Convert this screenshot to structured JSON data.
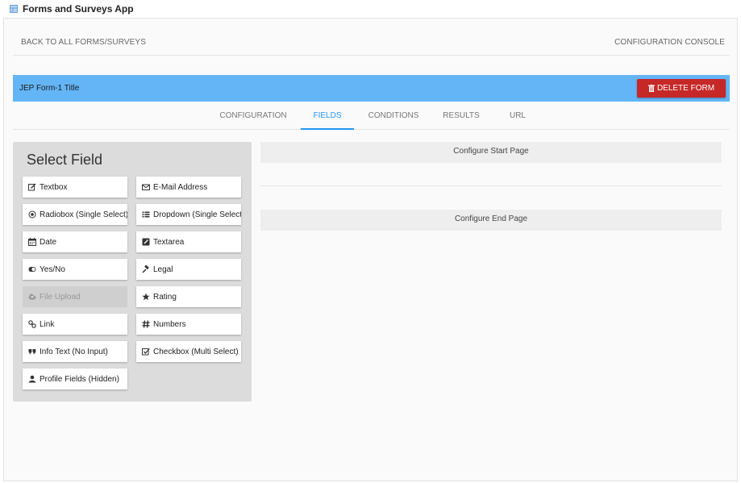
{
  "app": {
    "title": "Forms and Surveys App",
    "icon": "table-icon"
  },
  "topbar": {
    "back_label": "BACK TO ALL FORMS/SURVEYS",
    "console_label": "CONFIGURATION CONSOLE"
  },
  "form": {
    "title": "JEP Form-1 Title",
    "delete_label": "DELETE FORM",
    "banner_color": "#64b5f6",
    "delete_color": "#c62828"
  },
  "tabs": [
    {
      "label": "CONFIGURATION",
      "active": false
    },
    {
      "label": "FIELDS",
      "active": true
    },
    {
      "label": "CONDITIONS",
      "active": false
    },
    {
      "label": "RESULTS",
      "active": false
    },
    {
      "label": "URL",
      "active": false
    }
  ],
  "select_field": {
    "title": "Select Field",
    "fields": [
      {
        "label": "Textbox",
        "icon": "edit-icon",
        "enabled": true
      },
      {
        "label": "E-Mail Address",
        "icon": "envelope-icon",
        "enabled": true
      },
      {
        "label": "Radiobox (Single Select)",
        "icon": "radio-icon",
        "enabled": true
      },
      {
        "label": "Dropdown (Single Select)",
        "icon": "list-icon",
        "enabled": true
      },
      {
        "label": "Date",
        "icon": "calendar-icon",
        "enabled": true
      },
      {
        "label": "Textarea",
        "icon": "textarea-icon",
        "enabled": true
      },
      {
        "label": "Yes/No",
        "icon": "toggle-icon",
        "enabled": true
      },
      {
        "label": "Legal",
        "icon": "gavel-icon",
        "enabled": true
      },
      {
        "label": "File Upload",
        "icon": "cloud-upload-icon",
        "enabled": false
      },
      {
        "label": "Rating",
        "icon": "star-icon",
        "enabled": true
      },
      {
        "label": "Link",
        "icon": "link-icon",
        "enabled": true
      },
      {
        "label": "Numbers",
        "icon": "hash-icon",
        "enabled": true
      },
      {
        "label": "Info Text (No Input)",
        "icon": "quote-icon",
        "enabled": true
      },
      {
        "label": "Checkbox (Multi Select)",
        "icon": "checkbox-icon",
        "enabled": true
      },
      {
        "label": "Profile Fields (Hidden)",
        "icon": "user-icon",
        "enabled": true
      }
    ]
  },
  "pages": {
    "start_label": "Configure Start Page",
    "end_label": "Configure End Page"
  },
  "colors": {
    "accent": "#2196f3",
    "panel": "#dcdcdc"
  }
}
